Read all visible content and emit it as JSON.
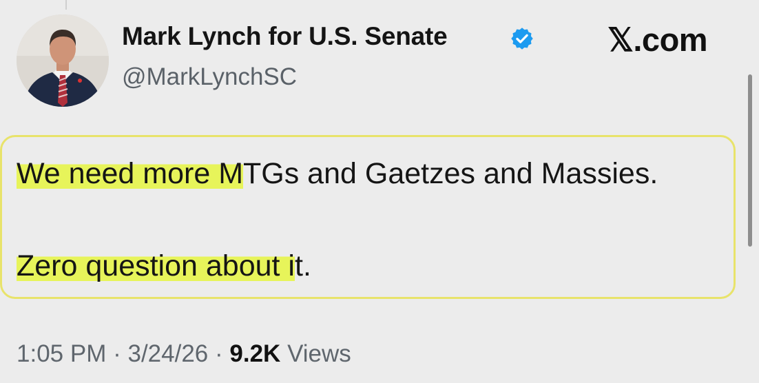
{
  "author": {
    "name": "Mark Lynch for U.S. Senate",
    "handle": "@MarkLynchSC",
    "verified_icon": "verified-badge-icon",
    "avatar": "profile-photo"
  },
  "brand": {
    "x_glyph": "𝕏",
    "domain": ".com"
  },
  "tweet": {
    "line1_highlighted": "We need more M",
    "line1_rest": "TGs and Gaetzes and Massies.",
    "line2_highlighted": "Zero question about i",
    "line2_rest": "t."
  },
  "meta": {
    "time": "1:05 PM",
    "separator": "·",
    "date": "3/24/26",
    "views_count": "9.2K",
    "views_label": "Views"
  },
  "colors": {
    "highlight": "#e7f45a",
    "box_border": "#e8e36a",
    "verified": "#1d9bf0",
    "background": "#ececec"
  }
}
